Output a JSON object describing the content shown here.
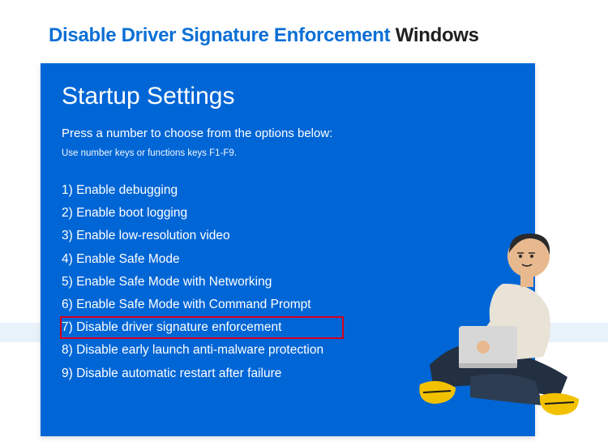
{
  "header": {
    "accent": "Disable Driver Signature Enforcement",
    "tail": " Windows"
  },
  "panel": {
    "title": "Startup Settings",
    "prompt": "Press a number to choose from the options below:",
    "hint": "Use number keys or functions keys F1-F9.",
    "options": [
      "1) Enable debugging",
      "2) Enable boot logging",
      "3) Enable low-resolution video",
      "4) Enable Safe Mode",
      "5) Enable Safe Mode with Networking",
      "6) Enable Safe Mode with Command Prompt",
      "7) Disable driver signature enforcement",
      "8) Disable early launch anti-malware protection",
      "9) Disable automatic restart after failure"
    ],
    "highlight_index": 6
  },
  "colors": {
    "panel_bg": "#0066d6",
    "accent": "#0b6fd6",
    "highlight": "#d6001c",
    "stripe": "#e8f2fb"
  }
}
